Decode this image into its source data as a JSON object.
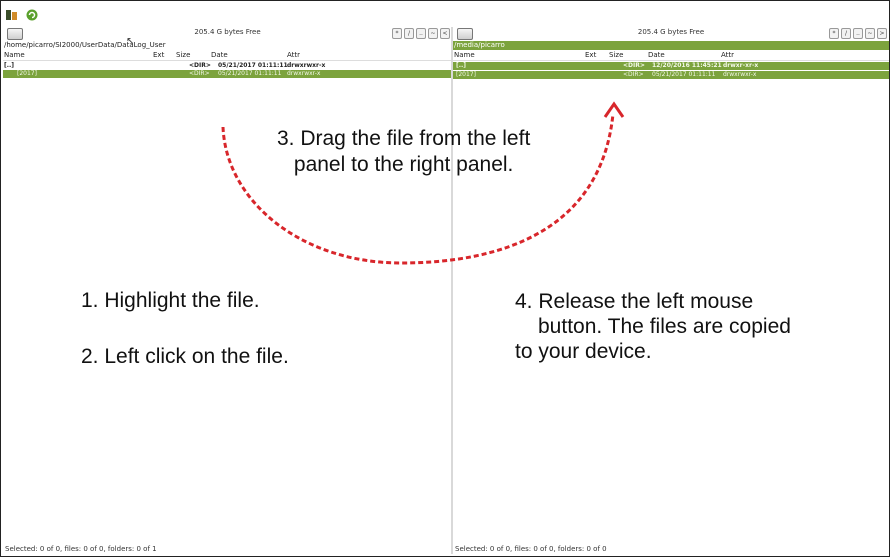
{
  "left_panel": {
    "free_space": "205.4 G bytes Free",
    "path": "/home/picarro/SI2000/UserData/DataLog_User",
    "nav_buttons": [
      "*",
      "/",
      "..",
      "~",
      "<"
    ],
    "columns": [
      "Name",
      "Ext",
      "Size",
      "Date",
      "Attr"
    ],
    "rows": [
      {
        "name": "[..]",
        "ext": "",
        "size": "<DIR>",
        "date": "05/21/2017 01:11:11",
        "attr": "drwxrwxr-x"
      },
      {
        "name": "[2017]",
        "ext": "",
        "size": "<DIR>",
        "date": "05/21/2017 01:11:11",
        "attr": "drwxrwxr-x"
      }
    ],
    "status": "Selected: 0 of 0, files: 0 of 0, folders: 0 of 1"
  },
  "right_panel": {
    "free_space": "205.4 G bytes Free",
    "path": "/media/picarro",
    "nav_buttons": [
      "*",
      "/",
      "..",
      "~",
      ">"
    ],
    "columns": [
      "Name",
      "Ext",
      "Size",
      "Date",
      "Attr"
    ],
    "rows": [
      {
        "name": "[..]",
        "ext": "",
        "size": "<DIR>",
        "date": "12/20/2016 11:45:21",
        "attr": "drwxr-xr-x"
      },
      {
        "name": "[2017]",
        "ext": "",
        "size": "<DIR>",
        "date": "05/21/2017 01:11:11",
        "attr": "drwxrwxr-x"
      }
    ],
    "status": "Selected: 0 of 0, files: 0 of 0, folders: 0 of 0"
  },
  "instructions": {
    "step1": "1. Highlight the file.",
    "step2": "2. Left click on the file.",
    "step3_line1": "3. Drag the file from the left",
    "step3_line2": "panel to the right panel.",
    "step4_line1": "4. Release the left mouse",
    "step4_line2": "button. The files are copied",
    "step4_line3": "to your device."
  },
  "colors": {
    "selection": "#7ca33d",
    "arrow": "#d8262b"
  },
  "icons": [
    "app-menu-icon",
    "refresh-icon",
    "drive-icon"
  ]
}
